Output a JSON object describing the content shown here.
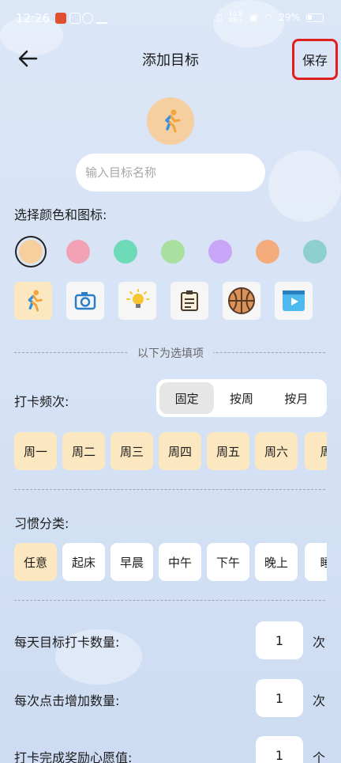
{
  "status_bar": {
    "time": "12:26",
    "network_speed": "10.8\nKB/s",
    "battery": "29%"
  },
  "header": {
    "back_icon": "arrow-left-icon",
    "title": "添加目标",
    "save_label": "保存"
  },
  "goal": {
    "avatar_icon": "running-person-icon",
    "name_placeholder": "输入目标名称",
    "name_value": ""
  },
  "appearance": {
    "label": "选择颜色和图标:",
    "colors": [
      "#f6cf9c",
      "#f2a2b4",
      "#6ddab8",
      "#a9e0a0",
      "#c9a6f7",
      "#f4ac7c",
      "#8ed0cf"
    ],
    "selected_color": "#f6cf9c",
    "icons": [
      "running-person-icon",
      "camera-icon",
      "lightbulb-icon",
      "clipboard-icon",
      "basketball-icon",
      "video-icon"
    ],
    "selected_icon": "running-person-icon"
  },
  "optional_divider": "以下为选填项",
  "frequency": {
    "label": "打卡频次:",
    "options": [
      "固定",
      "按周",
      "按月"
    ],
    "selected": "固定",
    "days": [
      "周一",
      "周二",
      "周三",
      "周四",
      "周五",
      "周六",
      "周"
    ]
  },
  "category": {
    "label": "习惯分类:",
    "options": [
      "任意",
      "起床",
      "早晨",
      "中午",
      "下午",
      "晚上",
      "睡"
    ],
    "selected": "任意"
  },
  "daily_target": {
    "label": "每天目标打卡数量:",
    "value": "1",
    "unit": "次"
  },
  "click_increment": {
    "label": "每次点击增加数量:",
    "value": "1",
    "unit": "次"
  },
  "reward": {
    "label": "打卡完成奖励心愿值:",
    "value": "1",
    "unit": "个"
  }
}
